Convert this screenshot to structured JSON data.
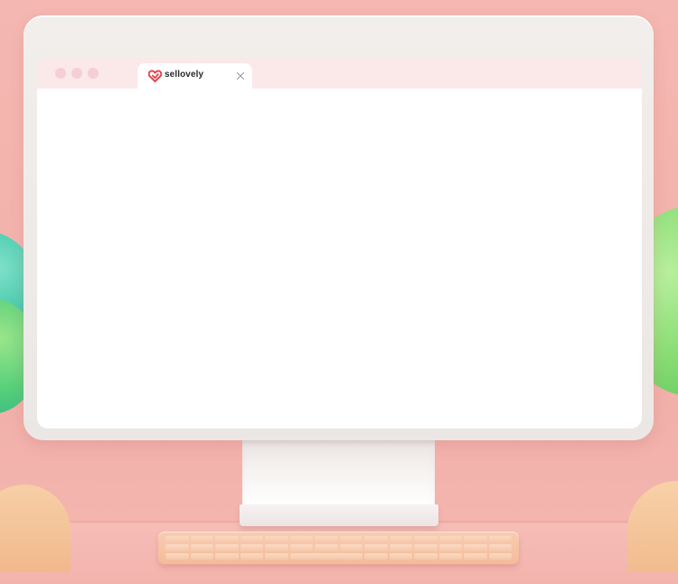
{
  "browser": {
    "window_controls": [
      "close",
      "minimize",
      "maximize"
    ],
    "tab": {
      "title": "sellovely",
      "logo_icon": "heart-logo-icon",
      "close_icon": "close-icon"
    }
  },
  "colors": {
    "background": "#f4b7b1",
    "monitor_frame": "#eeeae8",
    "titlebar": "#fbe8e9",
    "window_dot": "#f5cfd3",
    "logo_red": "#e8424b",
    "keyboard": "#f5c4a5",
    "blob_green": "#86dc73",
    "blob_teal": "#3ec7a8",
    "half_circle_peach": "#f4c398"
  }
}
